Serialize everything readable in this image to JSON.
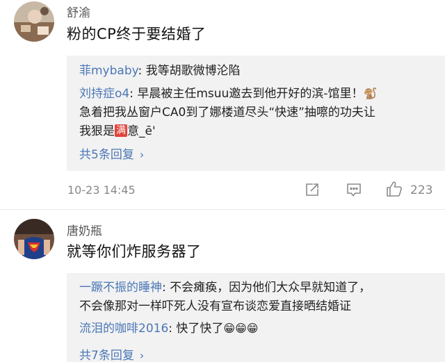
{
  "comments": [
    {
      "author": "舒渝",
      "text": "粉的CP终于要结婚了",
      "replies": [
        {
          "name": "菲mybaby",
          "sep": ": ",
          "text": "我等胡歌微博沦陷"
        },
        {
          "name": "刘持症o4",
          "sep": ": ",
          "text": "早晨被主任msuu邀去到他开好的滨-馆里！",
          "emoji": "🐒",
          "cont1": "急着把我丛窗户CA0到了娜楼道尽头“快速”抽嚓的功夫让",
          "cont2_pre": "我狠是",
          "badge": "满",
          "cont2_post": "意_ē'"
        }
      ],
      "more": "共5条回复",
      "chev": "›",
      "time": "10-23 14:45",
      "like_count": "223"
    },
    {
      "author": "唐奶瓶",
      "text": "就等你们炸服务器了",
      "replies": [
        {
          "name": "一蹶不振的睡神",
          "sep": ": ",
          "text": "不会瘫痪，因为他们大众早就知道了，",
          "cont1": "不会像那对一样吓死人没有宣布谈恋爱直接晒结婚证"
        },
        {
          "name": "流泪的咖啡2016",
          "sep": ": ",
          "text": "快了快了",
          "emoji": "😁😁😁"
        }
      ],
      "more": "共7条回复",
      "chev": "›"
    }
  ],
  "icons": {
    "share": "share-icon",
    "comment": "comment-icon",
    "like": "thumbs-up-icon"
  }
}
